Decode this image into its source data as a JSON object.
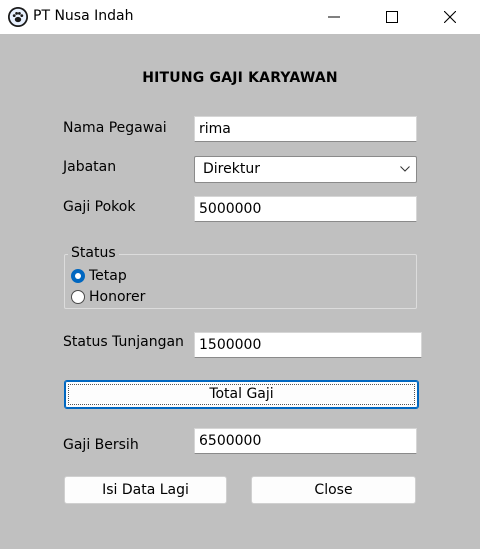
{
  "window": {
    "title": "PT Nusa Indah",
    "icon": "paw-icon"
  },
  "form": {
    "heading": "HITUNG GAJI KARYAWAN",
    "nama_label": "Nama Pegawai",
    "nama_value": "rima",
    "jabatan_label": "Jabatan",
    "jabatan_value": "Direktur",
    "gaji_pokok_label": "Gaji Pokok",
    "gaji_pokok_value": "5000000",
    "status_legend": "Status",
    "status_options": [
      "Tetap",
      "Honorer"
    ],
    "status_selected": "Tetap",
    "tunjangan_label": "Status Tunjangan",
    "tunjangan_value": "1500000",
    "total_button": "Total Gaji",
    "gaji_bersih_label": "Gaji Bersih",
    "gaji_bersih_value": "6500000",
    "isi_lagi_button": "Isi Data Lagi",
    "close_button": "Close"
  },
  "colors": {
    "accent": "#0067c0",
    "background": "#c0c0c0"
  }
}
